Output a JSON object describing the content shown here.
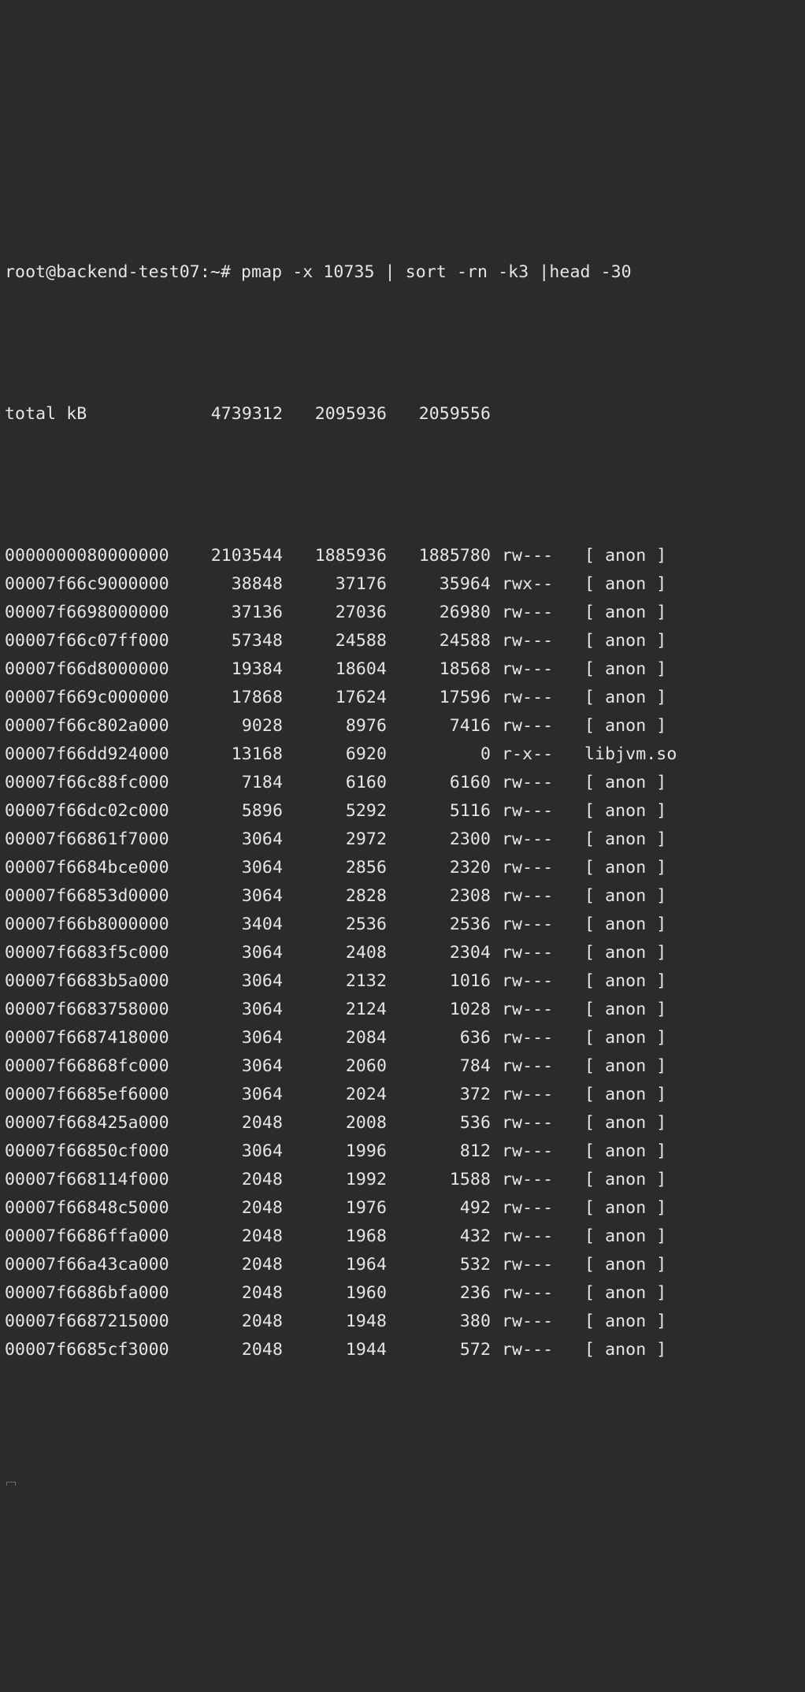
{
  "prompt": {
    "user": "root@backend-test07",
    "path": "~",
    "symbol": "#",
    "command": "pmap -x 10735 | sort -rn -k3 |head -30"
  },
  "total": {
    "label": "total kB",
    "kb": "4739312",
    "rss": "2095936",
    "dirty": "2059556"
  },
  "rows": [
    {
      "addr": "0000000080000000",
      "kb": "2103544",
      "rss": "1885936",
      "dirty": "1885780",
      "mode": "rw---",
      "map": "[ anon ]"
    },
    {
      "addr": "00007f66c9000000",
      "kb": "38848",
      "rss": "37176",
      "dirty": "35964",
      "mode": "rwx--",
      "map": "[ anon ]"
    },
    {
      "addr": "00007f6698000000",
      "kb": "37136",
      "rss": "27036",
      "dirty": "26980",
      "mode": "rw---",
      "map": "[ anon ]"
    },
    {
      "addr": "00007f66c07ff000",
      "kb": "57348",
      "rss": "24588",
      "dirty": "24588",
      "mode": "rw---",
      "map": "[ anon ]"
    },
    {
      "addr": "00007f66d8000000",
      "kb": "19384",
      "rss": "18604",
      "dirty": "18568",
      "mode": "rw---",
      "map": "[ anon ]"
    },
    {
      "addr": "00007f669c000000",
      "kb": "17868",
      "rss": "17624",
      "dirty": "17596",
      "mode": "rw---",
      "map": "[ anon ]"
    },
    {
      "addr": "00007f66c802a000",
      "kb": "9028",
      "rss": "8976",
      "dirty": "7416",
      "mode": "rw---",
      "map": "[ anon ]"
    },
    {
      "addr": "00007f66dd924000",
      "kb": "13168",
      "rss": "6920",
      "dirty": "0",
      "mode": "r-x--",
      "map": "libjvm.so"
    },
    {
      "addr": "00007f66c88fc000",
      "kb": "7184",
      "rss": "6160",
      "dirty": "6160",
      "mode": "rw---",
      "map": "[ anon ]"
    },
    {
      "addr": "00007f66dc02c000",
      "kb": "5896",
      "rss": "5292",
      "dirty": "5116",
      "mode": "rw---",
      "map": "[ anon ]"
    },
    {
      "addr": "00007f66861f7000",
      "kb": "3064",
      "rss": "2972",
      "dirty": "2300",
      "mode": "rw---",
      "map": "[ anon ]"
    },
    {
      "addr": "00007f6684bce000",
      "kb": "3064",
      "rss": "2856",
      "dirty": "2320",
      "mode": "rw---",
      "map": "[ anon ]"
    },
    {
      "addr": "00007f66853d0000",
      "kb": "3064",
      "rss": "2828",
      "dirty": "2308",
      "mode": "rw---",
      "map": "[ anon ]"
    },
    {
      "addr": "00007f66b8000000",
      "kb": "3404",
      "rss": "2536",
      "dirty": "2536",
      "mode": "rw---",
      "map": "[ anon ]"
    },
    {
      "addr": "00007f6683f5c000",
      "kb": "3064",
      "rss": "2408",
      "dirty": "2304",
      "mode": "rw---",
      "map": "[ anon ]"
    },
    {
      "addr": "00007f6683b5a000",
      "kb": "3064",
      "rss": "2132",
      "dirty": "1016",
      "mode": "rw---",
      "map": "[ anon ]"
    },
    {
      "addr": "00007f6683758000",
      "kb": "3064",
      "rss": "2124",
      "dirty": "1028",
      "mode": "rw---",
      "map": "[ anon ]"
    },
    {
      "addr": "00007f6687418000",
      "kb": "3064",
      "rss": "2084",
      "dirty": "636",
      "mode": "rw---",
      "map": "[ anon ]"
    },
    {
      "addr": "00007f66868fc000",
      "kb": "3064",
      "rss": "2060",
      "dirty": "784",
      "mode": "rw---",
      "map": "[ anon ]"
    },
    {
      "addr": "00007f6685ef6000",
      "kb": "3064",
      "rss": "2024",
      "dirty": "372",
      "mode": "rw---",
      "map": "[ anon ]"
    },
    {
      "addr": "00007f668425a000",
      "kb": "2048",
      "rss": "2008",
      "dirty": "536",
      "mode": "rw---",
      "map": "[ anon ]"
    },
    {
      "addr": "00007f66850cf000",
      "kb": "3064",
      "rss": "1996",
      "dirty": "812",
      "mode": "rw---",
      "map": "[ anon ]"
    },
    {
      "addr": "00007f668114f000",
      "kb": "2048",
      "rss": "1992",
      "dirty": "1588",
      "mode": "rw---",
      "map": "[ anon ]"
    },
    {
      "addr": "00007f66848c5000",
      "kb": "2048",
      "rss": "1976",
      "dirty": "492",
      "mode": "rw---",
      "map": "[ anon ]"
    },
    {
      "addr": "00007f6686ffa000",
      "kb": "2048",
      "rss": "1968",
      "dirty": "432",
      "mode": "rw---",
      "map": "[ anon ]"
    },
    {
      "addr": "00007f66a43ca000",
      "kb": "2048",
      "rss": "1964",
      "dirty": "532",
      "mode": "rw---",
      "map": "[ anon ]"
    },
    {
      "addr": "00007f6686bfa000",
      "kb": "2048",
      "rss": "1960",
      "dirty": "236",
      "mode": "rw---",
      "map": "[ anon ]"
    },
    {
      "addr": "00007f6687215000",
      "kb": "2048",
      "rss": "1948",
      "dirty": "380",
      "mode": "rw---",
      "map": "[ anon ]"
    },
    {
      "addr": "00007f6685cf3000",
      "kb": "2048",
      "rss": "1944",
      "dirty": "572",
      "mode": "rw---",
      "map": "[ anon ]"
    }
  ]
}
